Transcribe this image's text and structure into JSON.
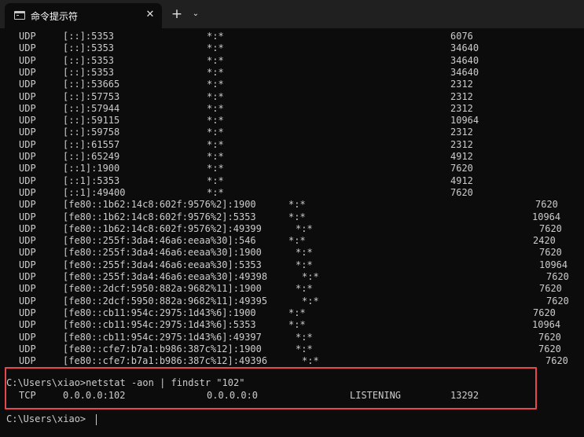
{
  "tab": {
    "title": "命令提示符",
    "close_glyph": "✕",
    "new_tab_glyph": "+",
    "dropdown_glyph": "⌄"
  },
  "terminal": {
    "rows": [
      {
        "proto": "UDP",
        "local": "[::]:5353",
        "foreign": "*:*",
        "pid": "6076"
      },
      {
        "proto": "UDP",
        "local": "[::]:5353",
        "foreign": "*:*",
        "pid": "34640"
      },
      {
        "proto": "UDP",
        "local": "[::]:5353",
        "foreign": "*:*",
        "pid": "34640"
      },
      {
        "proto": "UDP",
        "local": "[::]:5353",
        "foreign": "*:*",
        "pid": "34640"
      },
      {
        "proto": "UDP",
        "local": "[::]:53665",
        "foreign": "*:*",
        "pid": "2312"
      },
      {
        "proto": "UDP",
        "local": "[::]:57753",
        "foreign": "*:*",
        "pid": "2312"
      },
      {
        "proto": "UDP",
        "local": "[::]:57944",
        "foreign": "*:*",
        "pid": "2312"
      },
      {
        "proto": "UDP",
        "local": "[::]:59115",
        "foreign": "*:*",
        "pid": "10964"
      },
      {
        "proto": "UDP",
        "local": "[::]:59758",
        "foreign": "*:*",
        "pid": "2312"
      },
      {
        "proto": "UDP",
        "local": "[::]:61557",
        "foreign": "*:*",
        "pid": "2312"
      },
      {
        "proto": "UDP",
        "local": "[::]:65249",
        "foreign": "*:*",
        "pid": "4912"
      },
      {
        "proto": "UDP",
        "local": "[::1]:1900",
        "foreign": "*:*",
        "pid": "7620"
      },
      {
        "proto": "UDP",
        "local": "[::1]:5353",
        "foreign": "*:*",
        "pid": "4912"
      },
      {
        "proto": "UDP",
        "local": "[::1]:49400",
        "foreign": "*:*",
        "pid": "7620"
      },
      {
        "proto": "UDP",
        "local": "[fe80::1b62:14c8:602f:9576%2]:1900",
        "foreign": "*:*",
        "pid": "7620"
      },
      {
        "proto": "UDP",
        "local": "[fe80::1b62:14c8:602f:9576%2]:5353",
        "foreign": "*:*",
        "pid": "10964"
      },
      {
        "proto": "UDP",
        "local": "[fe80::1b62:14c8:602f:9576%2]:49399",
        "foreign": "*:*",
        "pid": "7620"
      },
      {
        "proto": "UDP",
        "local": "[fe80::255f:3da4:46a6:eeaa%30]:546",
        "foreign": "*:*",
        "pid": "2420"
      },
      {
        "proto": "UDP",
        "local": "[fe80::255f:3da4:46a6:eeaa%30]:1900",
        "foreign": "*:*",
        "pid": "7620"
      },
      {
        "proto": "UDP",
        "local": "[fe80::255f:3da4:46a6:eeaa%30]:5353",
        "foreign": "*:*",
        "pid": "10964"
      },
      {
        "proto": "UDP",
        "local": "[fe80::255f:3da4:46a6:eeaa%30]:49398",
        "foreign": "*:*",
        "pid": "7620"
      },
      {
        "proto": "UDP",
        "local": "[fe80::2dcf:5950:882a:9682%11]:1900",
        "foreign": "*:*",
        "pid": "7620"
      },
      {
        "proto": "UDP",
        "local": "[fe80::2dcf:5950:882a:9682%11]:49395",
        "foreign": "*:*",
        "pid": "7620"
      },
      {
        "proto": "UDP",
        "local": "[fe80::cb11:954c:2975:1d43%6]:1900",
        "foreign": "*:*",
        "pid": "7620"
      },
      {
        "proto": "UDP",
        "local": "[fe80::cb11:954c:2975:1d43%6]:5353",
        "foreign": "*:*",
        "pid": "10964"
      },
      {
        "proto": "UDP",
        "local": "[fe80::cb11:954c:2975:1d43%6]:49397",
        "foreign": "*:*",
        "pid": "7620"
      },
      {
        "proto": "UDP",
        "local": "[fe80::cfe7:b7a1:b986:387c%12]:1900",
        "foreign": "*:*",
        "pid": "7620"
      },
      {
        "proto": "UDP",
        "local": "[fe80::cfe7:b7a1:b986:387c%12]:49396",
        "foreign": "*:*",
        "pid": "7620"
      }
    ],
    "command": "C:\\Users\\xiao>netstat -aon | findstr \"102\"",
    "result": {
      "proto": "TCP",
      "local": "0.0.0.0:102",
      "foreign": "0.0.0.0:0",
      "state": "LISTENING",
      "pid": "13292"
    },
    "prompt": "C:\\Users\\xiao>"
  }
}
